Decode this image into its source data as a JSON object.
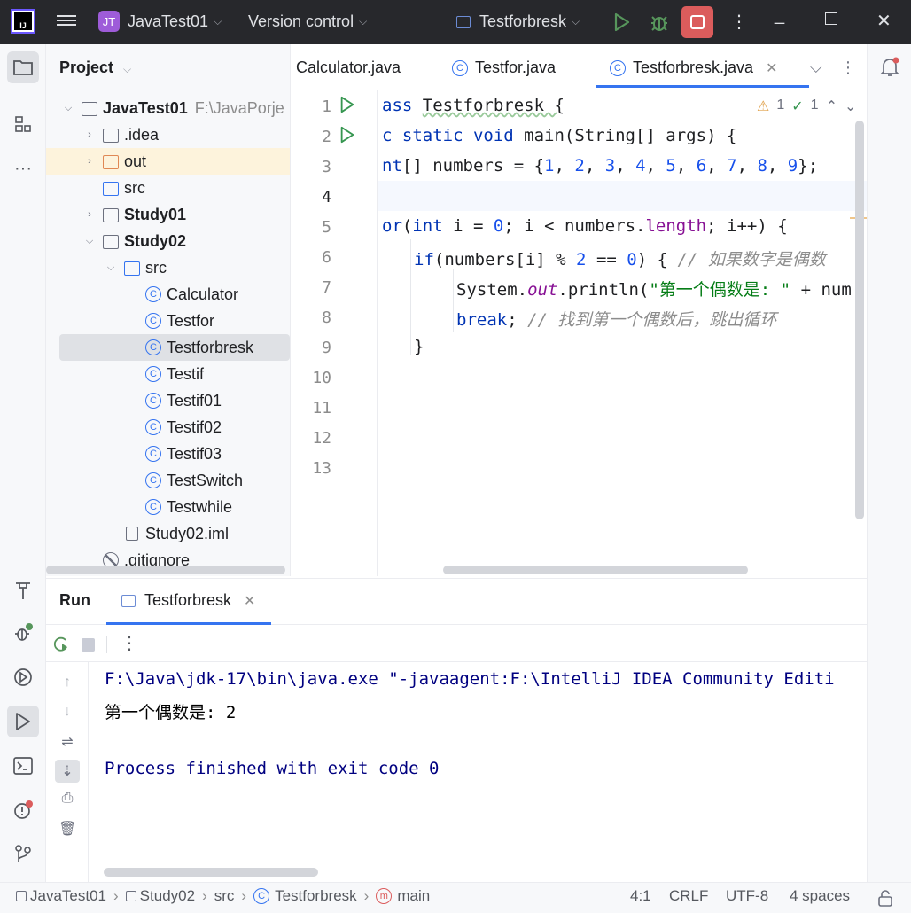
{
  "titlebar": {
    "project_badge": "JT",
    "project": "JavaTest01",
    "vcs": "Version control",
    "run_config": "Testforbresk"
  },
  "project_panel": {
    "title": "Project",
    "tree": [
      {
        "label": "JavaTest01",
        "path": "F:\\JavaPorje",
        "bold": true,
        "expanded": true
      },
      {
        "label": ".idea",
        "expandable": true
      },
      {
        "label": "out",
        "expandable": true
      },
      {
        "label": "src"
      },
      {
        "label": "Study01",
        "bold": true,
        "expandable": true
      },
      {
        "label": "Study02",
        "bold": true,
        "expanded": true
      },
      {
        "label": "src",
        "expanded": true
      },
      {
        "label": "Calculator"
      },
      {
        "label": "Testfor"
      },
      {
        "label": "Testforbresk"
      },
      {
        "label": "Testif"
      },
      {
        "label": "Testif01"
      },
      {
        "label": "Testif02"
      },
      {
        "label": "Testif03"
      },
      {
        "label": "TestSwitch"
      },
      {
        "label": "Testwhile"
      },
      {
        "label": "Study02.iml"
      },
      {
        "label": ".gitignore"
      }
    ]
  },
  "editor": {
    "tabs": [
      "Calculator.java",
      "Testfor.java",
      "Testforbresk.java"
    ],
    "active_tab": "Testforbresk.java",
    "inspection": {
      "warnings": "1",
      "ok": "1"
    },
    "line_numbers": [
      "1",
      "2",
      "3",
      "4",
      "5",
      "6",
      "7",
      "8",
      "9",
      "10",
      "11",
      "12",
      "13"
    ],
    "lines": {
      "l1a": "ass ",
      "l1b": "Testforbresk {",
      "l2a": "c static void ",
      "l2b": "main(String[] args) {",
      "l3a": "nt",
      "l3b": "[] numbers = {",
      "l3n": [
        "1",
        "2",
        "3",
        "4",
        "5",
        "6",
        "7",
        "8",
        "9"
      ],
      "l3e": "};",
      "l5a": "or",
      "l5b": "(",
      "l5c": "int ",
      "l5d": "i = ",
      "l5e": "0",
      "l5f": "; i < numbers.",
      "l5g": "length",
      "l5h": "; i++) {",
      "l6a": "if",
      "l6b": "(numbers[i] % ",
      "l6c": "2",
      "l6d": " == ",
      "l6e": "0",
      "l6f": ") { ",
      "l6g": "// 如果数字是偶数",
      "l7a": "System.",
      "l7b": "out",
      "l7c": ".println(",
      "l7d": "\"第一个偶数是: \"",
      "l7e": " + num",
      "l8a": "break",
      "l8b": "; ",
      "l8c": "// 找到第一个偶数后，跳出循环",
      "l9": "}"
    }
  },
  "run_panel": {
    "title": "Run",
    "tab": "Testforbresk",
    "output": [
      "F:\\Java\\jdk-17\\bin\\java.exe \"-javaagent:F:\\IntelliJ IDEA Community Editi",
      "第一个偶数是: 2",
      "",
      "Process finished with exit code 0"
    ]
  },
  "statusbar": {
    "breadcrumb": [
      "JavaTest01",
      "Study02",
      "src",
      "Testforbresk",
      "main"
    ],
    "position": "4:1",
    "line_sep": "CRLF",
    "encoding": "UTF-8",
    "indent": "4 spaces"
  }
}
